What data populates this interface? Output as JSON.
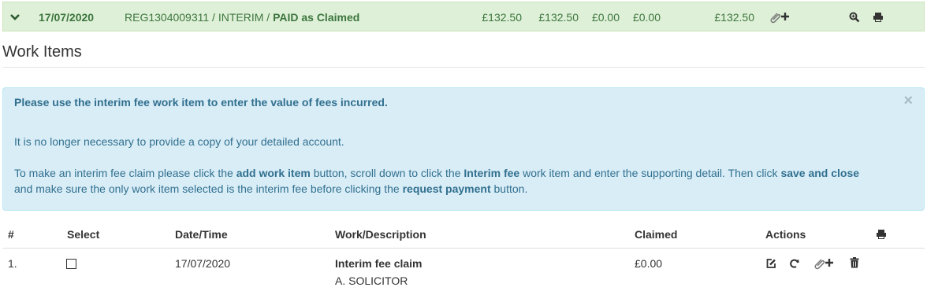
{
  "claim": {
    "date": "17/07/2020",
    "reference": "REG1304009311 / INTERIM / ",
    "status": "PAID as Claimed",
    "amounts": [
      "£132.50",
      "£132.50",
      "£0.00",
      "£0.00",
      "£132.50"
    ]
  },
  "section": {
    "title": "Work Items"
  },
  "alert": {
    "heading": "Please use the interim fee work item to enter the value of fees incurred.",
    "line1": "It is no longer necessary to provide a copy of your detailed account.",
    "line2": {
      "t1": "To make an interim fee claim please click the ",
      "b1": "add work item",
      "t2": " button, scroll down to click the ",
      "b2": "Interim fee",
      "t3": " work item and enter the supporting detail. Then click ",
      "b3": "save and close"
    },
    "line3": {
      "t1": "and make sure the only work item selected is the interim fee before clicking the ",
      "b1": "request payment",
      "t2": " button."
    },
    "close": "×"
  },
  "table": {
    "headers": {
      "num": "#",
      "select": "Select",
      "datetime": "Date/Time",
      "description": "Work/Description",
      "claimed": "Claimed",
      "actions": "Actions"
    },
    "rows": [
      {
        "num": "1.",
        "date": "17/07/2020",
        "title": "Interim fee claim",
        "subtitle": "A. SOLICITOR",
        "claimed": "£0.00"
      }
    ]
  },
  "colors": {
    "success_bg": "#dff0d8",
    "success_text": "#3c763d",
    "info_bg": "#d9edf7",
    "info_text": "#31708f"
  }
}
